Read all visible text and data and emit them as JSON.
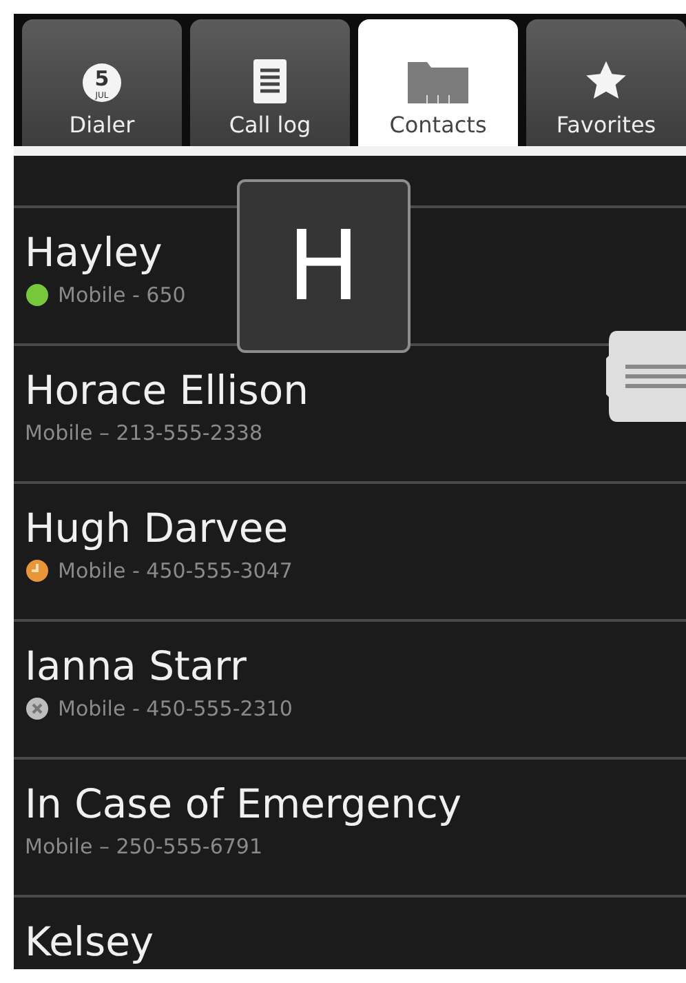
{
  "tabs": [
    {
      "label": "Dialer",
      "icon_day": "5",
      "icon_month": "JUL",
      "selected": false
    },
    {
      "label": "Call log",
      "selected": false
    },
    {
      "label": "Contacts",
      "selected": true
    },
    {
      "label": "Favorites",
      "selected": false
    }
  ],
  "fast_scroll_letter": "H",
  "contacts": [
    {
      "name": "Hayley",
      "detail": "Mobile - 650",
      "color": "#74c83a"
    },
    {
      "name": "Horace Ellison",
      "detail": "Mobile – 213-555-2338"
    },
    {
      "name": "Hugh Darvee",
      "detail": "Mobile - 450-555-3047",
      "color": "#e99636"
    },
    {
      "name": "Ianna Starr",
      "detail": "Mobile - 450-555-2310",
      "color": "#bdbdbd"
    },
    {
      "name": "In Case of Emergency",
      "detail": "Mobile – 250-555-6791"
    },
    {
      "name": "Kelsey"
    }
  ]
}
